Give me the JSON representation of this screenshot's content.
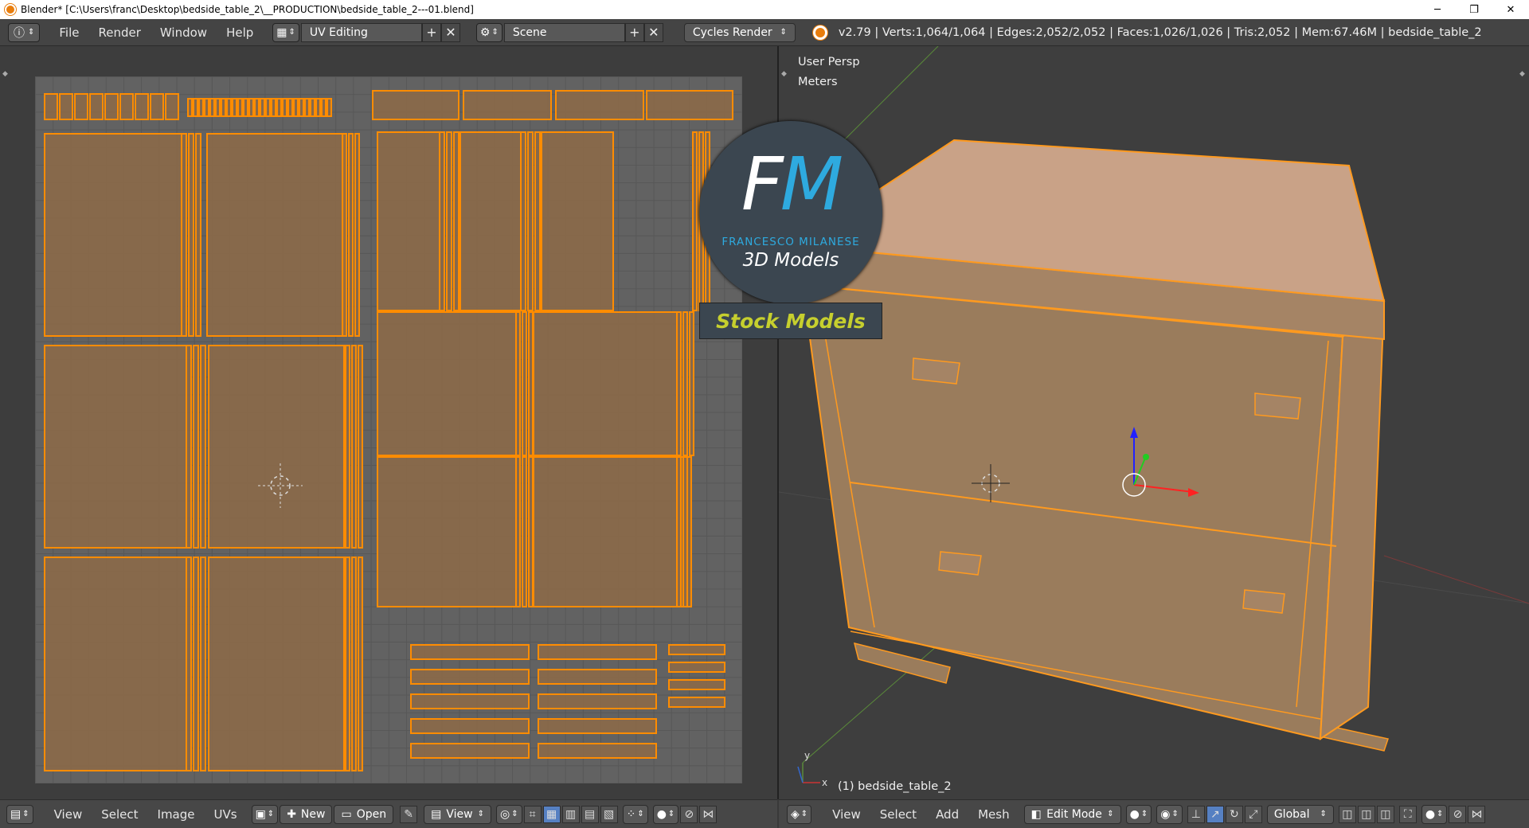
{
  "window": {
    "title": "Blender* [C:\\Users\\franc\\Desktop\\bedside_table_2\\__PRODUCTION\\bedside_table_2---01.blend]",
    "minimize_glyph": "─",
    "maximize_glyph": "❐",
    "close_glyph": "✕"
  },
  "info_header": {
    "menus": [
      "File",
      "Render",
      "Window",
      "Help"
    ],
    "screen_layout": "UV Editing",
    "scene": "Scene",
    "render_engine": "Cycles Render",
    "stats": "v2.79 | Verts:1,064/1,064 | Edges:2,052/2,052 | Faces:1,026/1,026 | Tris:2,052 | Mem:67.46M | bedside_table_2",
    "add_glyph": "+",
    "close_glyph": "✕"
  },
  "viewport": {
    "view_name": "User Persp",
    "units": "Meters",
    "object_label": "(1) bedside_table_2",
    "axis_x": "x",
    "axis_y": "y"
  },
  "logo": {
    "letter_f": "F",
    "letter_m": "M",
    "brand": "FRANCESCO MILANESE",
    "subtitle": "3D Models",
    "badge": "Stock Models"
  },
  "uv_footer": {
    "menus": [
      "View",
      "Select",
      "Image",
      "UVs"
    ],
    "new_label": "New",
    "open_label": "Open",
    "view_label": "View"
  },
  "vp_footer": {
    "menus": [
      "View",
      "Select",
      "Add",
      "Mesh"
    ],
    "mode": "Edit Mode",
    "orientation": "Global"
  },
  "colors": {
    "uv_face": "#8e6b48",
    "uv_edge": "#ff8c00",
    "mesh_face": "#9a7c5c",
    "mesh_top": "#c9a287",
    "mesh_edge": "#ff9a1f",
    "brand_blue": "#2eaadf",
    "badge_yellow": "#c6cf2e"
  },
  "icons": [
    "blender-icon",
    "info-icon",
    "layout-icon",
    "scene-icon",
    "render-icon",
    "uv-editor-icon",
    "view3d-icon",
    "pin-icon",
    "vertex-select-icon",
    "edge-select-icon",
    "face-select-icon",
    "manipulator-icon"
  ]
}
